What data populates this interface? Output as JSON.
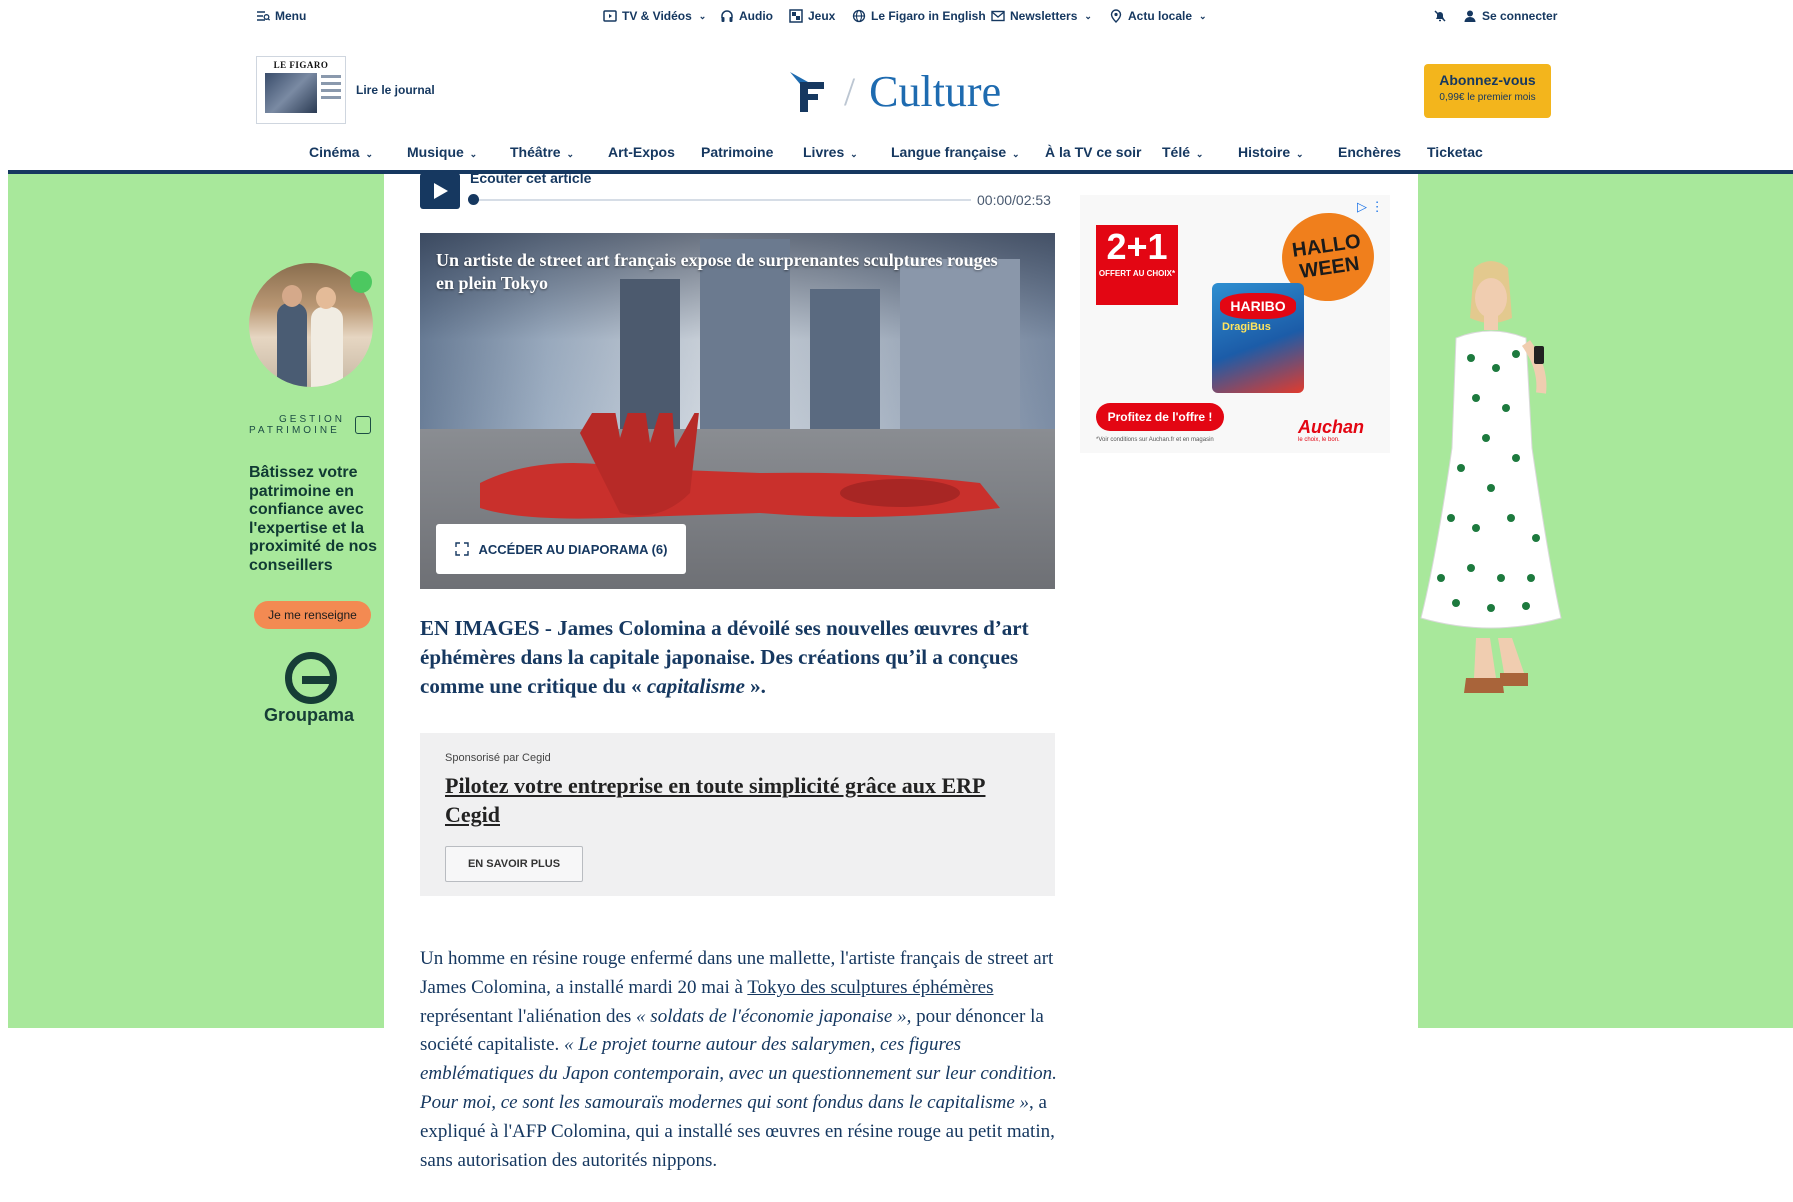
{
  "utilbar": {
    "menu": "Menu",
    "tv_videos": "TV & Vidéos",
    "audio": "Audio",
    "jeux": "Jeux",
    "english": "Le Figaro in English",
    "newsletters": "Newsletters",
    "actu_locale": "Actu locale",
    "login": "Se connecter"
  },
  "header": {
    "read_paper": "Lire le journal",
    "paper_masthead": "LE FIGARO",
    "logo_letter": "F",
    "section": "Culture",
    "subscribe_title": "Abonnez-vous",
    "subscribe_sub": "0,99€ le premier mois"
  },
  "nav": {
    "items": [
      "Cinéma",
      "Musique",
      "Théâtre",
      "Art-Expos",
      "Patrimoine",
      "Livres",
      "Langue française",
      "À la TV ce soir",
      "Télé",
      "Histoire",
      "Enchères",
      "Ticketac"
    ]
  },
  "audio": {
    "label": "Écouter cet article",
    "time": "00:00/02:53",
    "progress": 0
  },
  "hero": {
    "caption": "Un artiste de street art français expose de surprenantes sculptures rouges en plein Tokyo",
    "diaporama": "ACCÉDER AU DIAPORAMA (6)"
  },
  "article": {
    "lead_prefix": "EN IMAGES - James Colomina a dévoilé ses nouvelles œuvres d’art éphémères dans la capitale japonaise. Des créations qu’il a conçues comme une critique du « ",
    "lead_em": "capitalisme",
    "lead_suffix": " ».",
    "p1_a": "Un homme en résine rouge enfermé dans une mallette, l'artiste français de street art James Colomina, a installé mardi 20 mai à ",
    "p1_link": "Tokyo des sculptures éphémères",
    "p1_b": " représentant l'aliénation des ",
    "p1_q1": "« soldats de l'économie japonaise »",
    "p1_c": ", pour dénoncer la société capitaliste. ",
    "p1_q2": "« Le projet tourne autour des salarymen, ces figures emblématiques du Japon contemporain, avec un questionnement sur leur condition. Pour moi, ce sont les samouraïs modernes qui sont fondus dans le capitalisme »",
    "p1_d": ", a expliqué à l'AFP Colomina, qui a installé ses œuvres en résine rouge au petit matin, sans autorisation des autorités nippons."
  },
  "sponsored": {
    "by": "Sponsorisé par Cegid",
    "title": "Pilotez votre entreprise en toute simplicité grâce aux ERP Cegid",
    "cta": "EN SAVOIR PLUS"
  },
  "ad_right": {
    "promo_big": "2+1",
    "promo_small": "OFFERT AU CHOIX*",
    "halloween": "HALLO WEEN",
    "brand": "HARIBO",
    "product": "DragiBus",
    "cta": "Profitez de l'offre !",
    "fine": "*Voir conditions sur Auchan.fr et en magasin",
    "retailer": "Auchan",
    "tagline": "le choix, le bon."
  },
  "ad_left": {
    "brand_l1": "GESTION",
    "brand_l2": "PATRIMOINE",
    "text": "Bâtissez votre patrimoine en confiance avec l'expertise et la proximité de nos conseillers",
    "cta": "Je me renseigne",
    "logo": "Groupama"
  },
  "colors": {
    "navy": "#163860",
    "accent_blue": "#1e6bb0",
    "subscribe_yellow": "#f3b51c",
    "skin_green": "#a8e89b"
  }
}
